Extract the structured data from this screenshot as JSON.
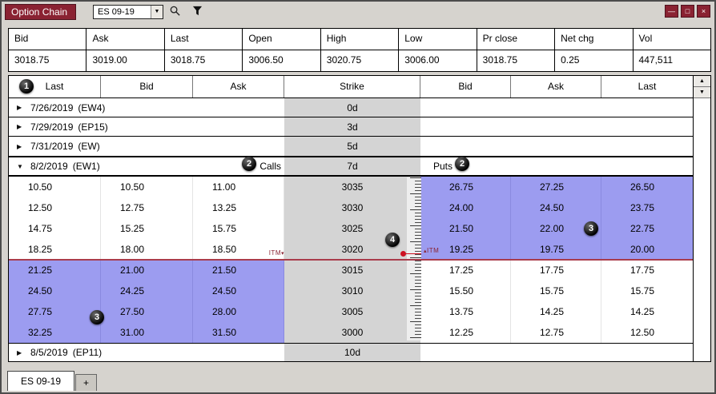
{
  "window": {
    "title": "Option Chain",
    "symbol": "ES 09-19",
    "controls": {
      "minimize": "—",
      "restore": "□",
      "close": "×"
    }
  },
  "icons": {
    "dropdown_arrow": "▼",
    "collapsed_arrow": "▶",
    "expanded_arrow": "▼",
    "scroll_up": "▲",
    "scroll_down": "▼",
    "itm_marker_down": "▾",
    "itm_marker_up": "▴"
  },
  "quote": {
    "headers": [
      "Bid",
      "Ask",
      "Last",
      "Open",
      "High",
      "Low",
      "Pr close",
      "Net chg",
      "Vol"
    ],
    "values": [
      "3018.75",
      "3019.00",
      "3018.75",
      "3006.50",
      "3020.75",
      "3006.00",
      "3018.75",
      "0.25",
      "447,511"
    ]
  },
  "chain": {
    "headers": [
      "Last",
      "Bid",
      "Ask",
      "Strike",
      "Bid",
      "Ask",
      "Last"
    ],
    "itm_label": "ITM",
    "groups": [
      {
        "date": "7/26/2019",
        "code": "(EW4)",
        "dte": "0d",
        "expanded": false,
        "rows": []
      },
      {
        "date": "7/29/2019",
        "code": "(EP15)",
        "dte": "3d",
        "expanded": false,
        "rows": []
      },
      {
        "date": "7/31/2019",
        "code": "(EW)",
        "dte": "5d",
        "expanded": false,
        "rows": []
      },
      {
        "date": "8/2/2019",
        "code": "(EW1)",
        "dte": "7d",
        "expanded": true,
        "calls_label": "Calls",
        "puts_label": "Puts",
        "rows": [
          {
            "strike": "3035",
            "call_last": "10.50",
            "call_bid": "10.50",
            "call_ask": "11.00",
            "put_bid": "26.75",
            "put_ask": "27.25",
            "put_last": "26.50",
            "put_itm": true
          },
          {
            "strike": "3030",
            "call_last": "12.50",
            "call_bid": "12.75",
            "call_ask": "13.25",
            "put_bid": "24.00",
            "put_ask": "24.50",
            "put_last": "23.75",
            "put_itm": true
          },
          {
            "strike": "3025",
            "call_last": "14.75",
            "call_bid": "15.25",
            "call_ask": "15.75",
            "put_bid": "21.50",
            "put_ask": "22.00",
            "put_last": "22.75",
            "put_itm": true
          },
          {
            "strike": "3020",
            "call_last": "18.25",
            "call_bid": "18.00",
            "call_ask": "18.50",
            "put_bid": "19.25",
            "put_ask": "19.75",
            "put_last": "20.00",
            "put_itm": true
          },
          {
            "strike": "3015",
            "call_last": "21.25",
            "call_bid": "21.00",
            "call_ask": "21.50",
            "put_bid": "17.25",
            "put_ask": "17.75",
            "put_last": "17.75",
            "call_itm": true
          },
          {
            "strike": "3010",
            "call_last": "24.50",
            "call_bid": "24.25",
            "call_ask": "24.50",
            "put_bid": "15.50",
            "put_ask": "15.75",
            "put_last": "15.75",
            "call_itm": true
          },
          {
            "strike": "3005",
            "call_last": "27.75",
            "call_bid": "27.50",
            "call_ask": "28.00",
            "put_bid": "13.75",
            "put_ask": "14.25",
            "put_last": "14.25",
            "call_itm": true
          },
          {
            "strike": "3000",
            "call_last": "32.25",
            "call_bid": "31.00",
            "call_ask": "31.50",
            "put_bid": "12.25",
            "put_ask": "12.75",
            "put_last": "12.50",
            "call_itm": true
          }
        ]
      },
      {
        "date": "8/5/2019",
        "code": "(EP11)",
        "dte": "10d",
        "expanded": false,
        "rows": []
      }
    ]
  },
  "tabs": [
    {
      "label": "ES 09-19",
      "active": true
    },
    {
      "label": "+",
      "active": false
    }
  ],
  "annotations": [
    {
      "label": "1"
    },
    {
      "label": "2"
    },
    {
      "label": "2"
    },
    {
      "label": "3"
    },
    {
      "label": "3"
    },
    {
      "label": "4"
    }
  ],
  "colors": {
    "accent_red": "#8a2232",
    "itm_highlight": "#9c9cf0",
    "price_line": "#a93c4c",
    "strike_bg": "#d4d4d4"
  }
}
